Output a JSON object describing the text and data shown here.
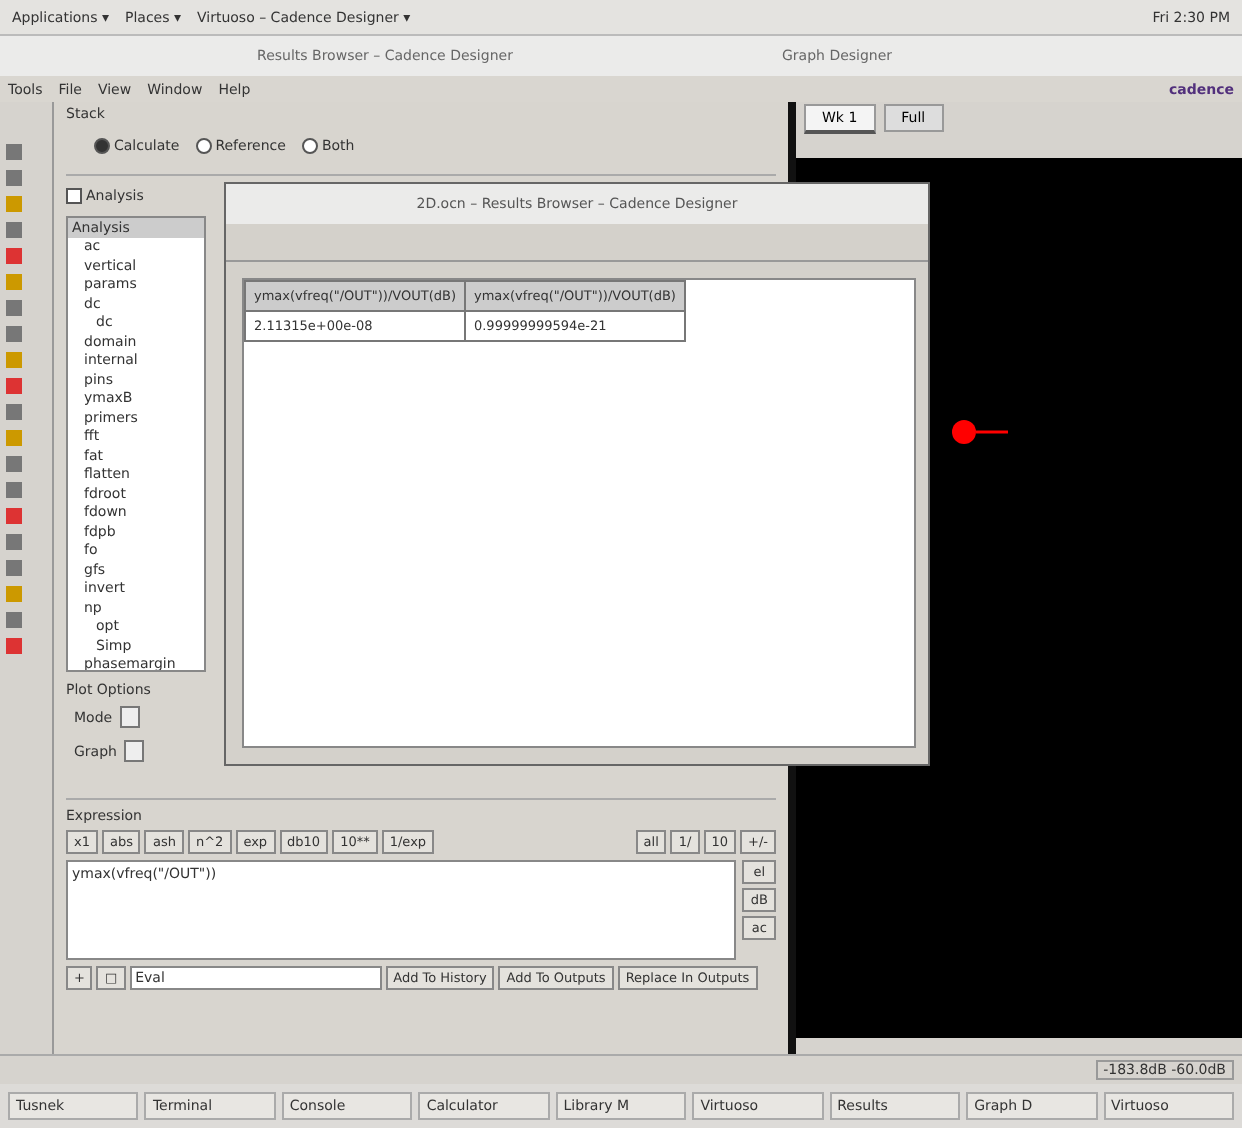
{
  "top_panel": {
    "menus": [
      "Applications ▾",
      "Places ▾",
      "Virtuoso – Cadence Designer ▾"
    ],
    "clock": "Fri 2:30 PM"
  },
  "main_window": {
    "title": "Results Browser – Cadence Designer",
    "menus": [
      "Tools",
      "File",
      "View",
      "Window",
      "Help"
    ],
    "brand": "cadence"
  },
  "side_window": {
    "title": "Graph Designer",
    "tabs": [
      {
        "label": "Wk 1",
        "selected": true
      },
      {
        "label": "Full",
        "selected": false
      }
    ]
  },
  "calculator": {
    "section": "Stack",
    "radios": [
      {
        "label": "Calculate",
        "selected": true
      },
      {
        "label": "Reference",
        "selected": false
      },
      {
        "label": "Both",
        "selected": false
      }
    ],
    "analysis_check": {
      "label": "Analysis",
      "checked": false
    },
    "list_header": "Analysis",
    "tree": [
      {
        "label": "ac"
      },
      {
        "label": "vertical"
      },
      {
        "label": "params"
      },
      {
        "label": "dc",
        "children": [
          {
            "label": "dc"
          }
        ]
      },
      {
        "label": "domain"
      },
      {
        "label": "internal"
      },
      {
        "label": "pins"
      },
      {
        "label": "ymaxB"
      },
      {
        "label": "primers"
      },
      {
        "label": "fft"
      },
      {
        "label": "fat"
      },
      {
        "label": "flatten"
      },
      {
        "label": "fdroot"
      },
      {
        "label": "fdown"
      },
      {
        "label": "fdpb"
      },
      {
        "label": "fo"
      },
      {
        "label": "gfs"
      },
      {
        "label": "invert"
      },
      {
        "label": "np",
        "children": [
          {
            "label": "opt"
          },
          {
            "label": "Simp"
          }
        ]
      },
      {
        "label": "phasemargin"
      }
    ],
    "plot_options": "Plot Options",
    "mode_label": "Mode",
    "graph_label": "Graph",
    "expression_label": "Expression",
    "func_buttons": [
      "x1",
      "abs",
      "ash",
      "n^2",
      "exp",
      "db10",
      "10**",
      "1/exp"
    ],
    "key_buttons": [
      "all",
      "1/",
      "10",
      "+/-"
    ],
    "side_keys": [
      "el",
      "dB",
      "ac"
    ],
    "expression": "ymax(vfreq(\"/OUT\"))",
    "small_buttons": [
      "+",
      "□"
    ],
    "input_value": "Eval",
    "action_buttons": [
      "Add To History",
      "Add To Outputs",
      "Replace In Outputs"
    ]
  },
  "results_dialog": {
    "title": "2D.ocn – Results Browser – Cadence Designer",
    "columns": [
      "ymax(vfreq(\"/OUT\"))/VOUT(dB)",
      "ymax(vfreq(\"/OUT\"))/VOUT(dB)"
    ],
    "rows": [
      [
        "2.11315e+00e-08",
        "0.99999999594e-21"
      ]
    ]
  },
  "status_bar": "-183.8dB  -60.0dB",
  "taskbar": [
    "Tusnek",
    "Terminal",
    "Console",
    "Calculator",
    "Library M",
    "Virtuoso",
    "Results",
    "Graph D",
    "Virtuoso"
  ]
}
